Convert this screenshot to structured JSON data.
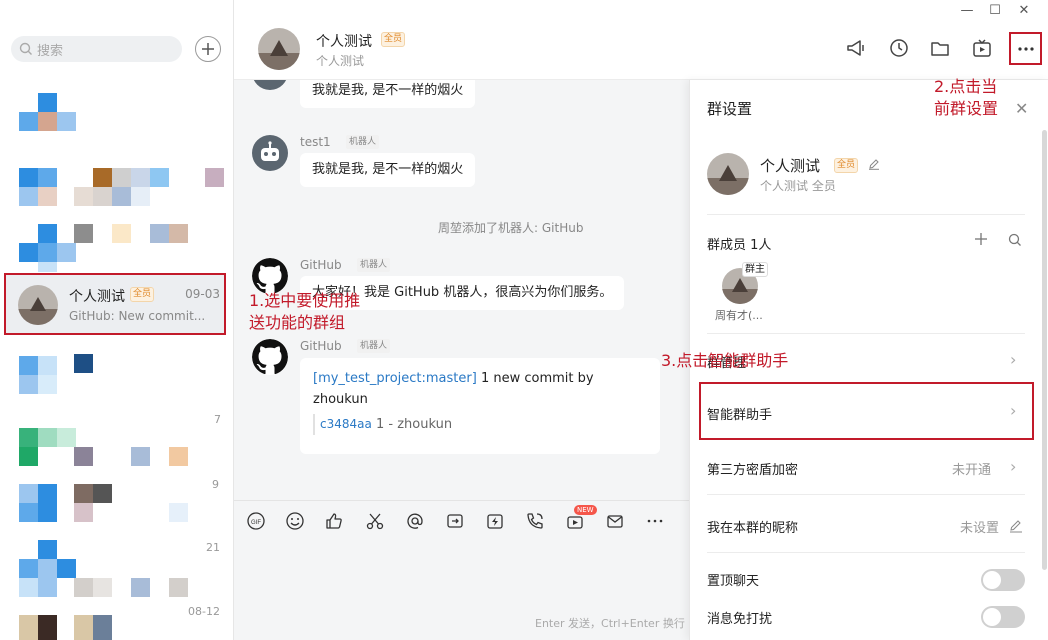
{
  "window": {
    "minimize": "—",
    "maximize": "☐",
    "close": "✕"
  },
  "sidebar": {
    "search_placeholder": "搜索",
    "active_chat": {
      "name": "个人测试",
      "badge": "全员",
      "time": "09-03",
      "preview": "GitHub: New commit..."
    },
    "blurred_times": [
      "7",
      "9",
      "21",
      "08-12"
    ]
  },
  "header": {
    "name": "个人测试",
    "badge": "全员",
    "sub": "个人测试"
  },
  "messages": {
    "top_bubble": "我就是我, 是不一样的烟火",
    "m1": {
      "sender": "test1",
      "tag": "机器人",
      "text": "我就是我, 是不一样的烟火"
    },
    "system": "周堃添加了机器人: GitHub",
    "m2": {
      "sender": "GitHub",
      "tag": "机器人",
      "text": "大家好！我是 GitHub 机器人，很高兴为你们服务。"
    },
    "m3": {
      "sender": "GitHub",
      "tag": "机器人",
      "link": "[my_test_project:master]",
      "line1_rest": " 1 new commit by",
      "line2": "zhoukun",
      "sha": "c3484aa",
      "commit_msg": " 1 - zhoukun"
    }
  },
  "composer": {
    "hint": "Enter 发送，Ctrl+Enter 换行",
    "new_badge": "NEW"
  },
  "settings": {
    "title": "群设置",
    "group_name": "个人测试",
    "group_badge": "全员",
    "group_sub": "个人测试 全员",
    "members_label": "群成员 1人",
    "owner_tag": "群主",
    "member_name": "周有才(...",
    "row_manage": "群管理",
    "row_assistant": "智能群助手",
    "row_encrypt": "第三方密盾加密",
    "row_encrypt_value": "未开通",
    "row_nickname": "我在本群的昵称",
    "row_nickname_value": "未设置",
    "row_pin": "置顶聊天",
    "row_mute": "消息免打扰",
    "pin_on": false,
    "mute_on": false
  },
  "annotations": {
    "step1_line1": "1.选中要使用推",
    "step1_line2": "送功能的群组",
    "step2_line1": "2.点击当",
    "step2_line2": "前群设置",
    "step3": "3.点击智能群助手"
  },
  "colors": {
    "annotation_red": "#c21a2a",
    "link_blue": "#2a79c5",
    "badge_orange": "#e08a2c"
  }
}
